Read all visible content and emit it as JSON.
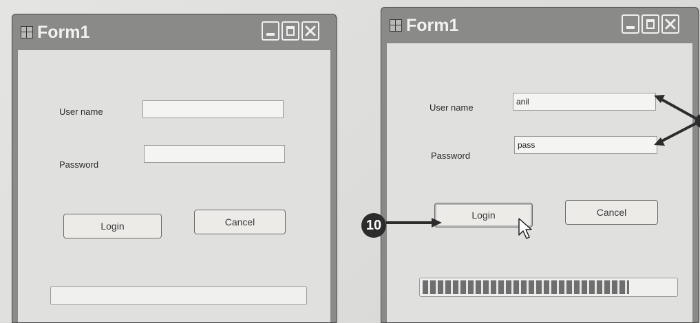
{
  "left_window": {
    "title": "Form1",
    "username_label": "User name",
    "username_value": "",
    "password_label": "Password",
    "password_value": "",
    "login_label": "Login",
    "cancel_label": "Cancel",
    "progress": 0
  },
  "right_window": {
    "title": "Form1",
    "username_label": "User name",
    "username_value": "anil",
    "password_label": "Password",
    "password_value": "pass",
    "login_label": "Login",
    "cancel_label": "Cancel",
    "progress": 0.82
  },
  "callout": {
    "number": "10"
  },
  "icons": {
    "app": "form-app-icon",
    "minimize": "minimize-icon",
    "maximize": "maximize-icon",
    "close": "close-icon",
    "cursor": "mouse-pointer-icon",
    "arrow": "callout-arrow-icon"
  }
}
